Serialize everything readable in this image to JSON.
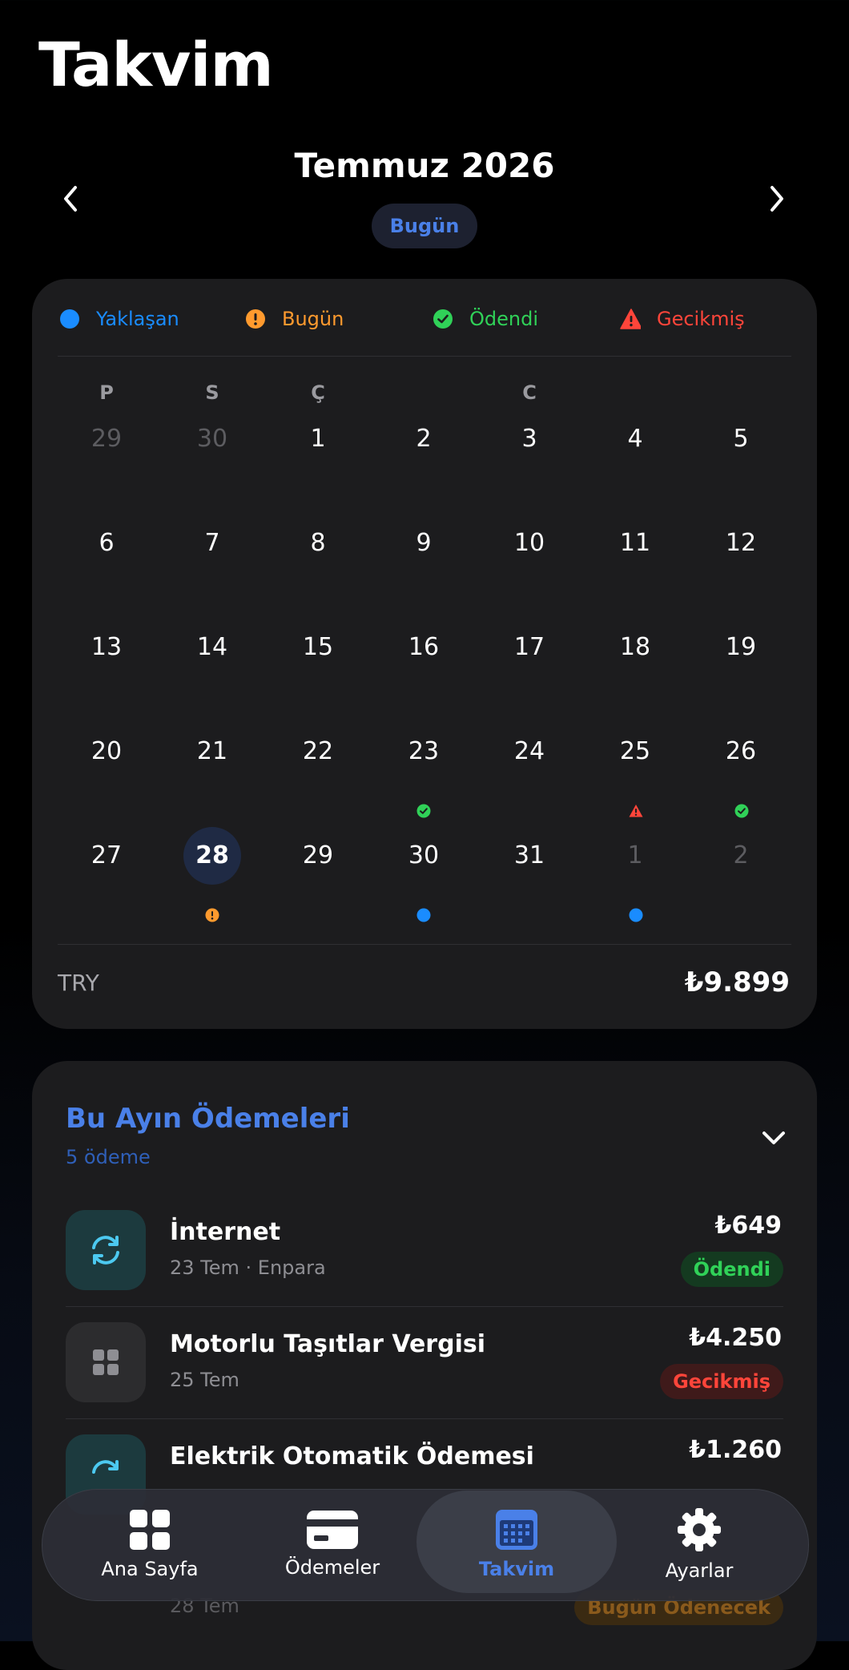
{
  "page": {
    "title": "Takvim"
  },
  "calendar": {
    "month_label": "Temmuz 2026",
    "today_button": "Bugün",
    "legend": [
      {
        "label": "Yaklaşan",
        "color": "#1a8cff",
        "icon": "dot-icon"
      },
      {
        "label": "Bugün",
        "color": "#ff9a2e",
        "icon": "exclamation-circle-icon"
      },
      {
        "label": "Ödendi",
        "color": "#30d158",
        "icon": "check-circle-icon"
      },
      {
        "label": "Gecikmiş",
        "color": "#ff453a",
        "icon": "warning-triangle-icon"
      }
    ],
    "weekdays": [
      "P",
      "S",
      "Ç",
      "",
      "C",
      "",
      ""
    ],
    "weeks": [
      [
        "29",
        "30",
        "1",
        "2",
        "3",
        "4",
        "5"
      ],
      [
        "6",
        "7",
        "8",
        "9",
        "10",
        "11",
        "12"
      ],
      [
        "13",
        "14",
        "15",
        "16",
        "17",
        "18",
        "19"
      ],
      [
        "20",
        "21",
        "22",
        "23",
        "24",
        "25",
        "26"
      ],
      [
        "27",
        "28",
        "29",
        "30",
        "31",
        "1",
        "2"
      ]
    ],
    "today": "28",
    "summary": {
      "currency": "TRY",
      "total": "₺9.899"
    }
  },
  "payments": {
    "title": "Bu Ayın Ödemeleri",
    "count": "5 ödeme",
    "items": [
      {
        "name": "İnternet",
        "date": "23 Tem",
        "source": "Enpara",
        "amount": "₺649",
        "status": "Ödendi",
        "icon": "sync-icon"
      },
      {
        "name": "Motorlu Taşıtlar Vergisi",
        "date": "25 Tem",
        "amount": "₺4.250",
        "status": "Gecikmiş",
        "icon": "grid-icon"
      },
      {
        "name": "Elektrik Otomatik Ödemesi",
        "amount": "₺1.260",
        "icon": "sync-icon"
      },
      {
        "date": "28 Tem",
        "status": "Bugün Ödenecek"
      }
    ]
  },
  "tabbar": {
    "tabs": [
      {
        "label": "Ana Sayfa",
        "icon": "home-grid-icon"
      },
      {
        "label": "Ödemeler",
        "icon": "credit-card-icon"
      },
      {
        "label": "Takvim",
        "icon": "calendar-icon"
      },
      {
        "label": "Ayarlar",
        "icon": "gear-icon"
      }
    ],
    "active": "Takvim"
  },
  "colors": {
    "accent": "#4a80e8",
    "upcoming": "#1a8cff",
    "today": "#ff9a2e",
    "paid": "#30d158",
    "overdue": "#ff453a"
  }
}
